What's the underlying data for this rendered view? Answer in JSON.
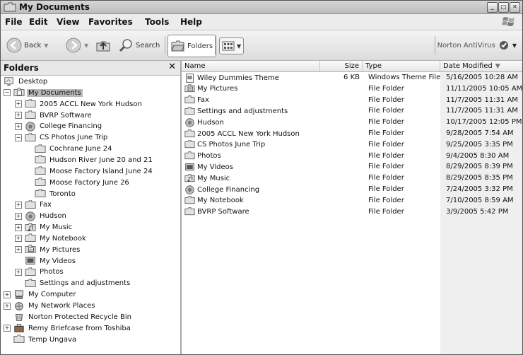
{
  "window": {
    "title": "My Documents",
    "controls": [
      "minimize",
      "maximize",
      "close"
    ]
  },
  "menubar": {
    "items": [
      "File",
      "Edit",
      "View",
      "Favorites",
      "Tools",
      "Help"
    ]
  },
  "toolbar": {
    "back_label": "Back",
    "search_label": "Search",
    "folders_label": "Folders",
    "norton_label": "Norton AntiVirus"
  },
  "folders_pane": {
    "title": "Folders",
    "tree": [
      {
        "label": "Desktop",
        "icon": "desktop-icon",
        "depth": 0,
        "expander": "none"
      },
      {
        "label": "My Documents",
        "icon": "my-documents-icon",
        "depth": 1,
        "expander": "minus",
        "selected": true
      },
      {
        "label": "2005 ACCL New York Hudson",
        "icon": "folder-icon",
        "depth": 2,
        "expander": "plus"
      },
      {
        "label": "BVRP Software",
        "icon": "folder-icon",
        "depth": 2,
        "expander": "plus"
      },
      {
        "label": "College Financing",
        "icon": "special-folder-icon",
        "depth": 2,
        "expander": "plus"
      },
      {
        "label": "CS Photos June Trip",
        "icon": "folder-icon",
        "depth": 2,
        "expander": "minus"
      },
      {
        "label": "Cochrane June 24",
        "icon": "folder-icon",
        "depth": 3,
        "expander": "none"
      },
      {
        "label": "Hudson River June 20 and 21",
        "icon": "folder-icon",
        "depth": 3,
        "expander": "none"
      },
      {
        "label": "Moose Factory Island June 24",
        "icon": "folder-icon",
        "depth": 3,
        "expander": "none"
      },
      {
        "label": "Moose Factory June 26",
        "icon": "folder-icon",
        "depth": 3,
        "expander": "none"
      },
      {
        "label": "Toronto",
        "icon": "folder-icon",
        "depth": 3,
        "expander": "none"
      },
      {
        "label": "Fax",
        "icon": "folder-icon",
        "depth": 2,
        "expander": "plus"
      },
      {
        "label": "Hudson",
        "icon": "special-folder-icon",
        "depth": 2,
        "expander": "plus"
      },
      {
        "label": "My Music",
        "icon": "music-folder-icon",
        "depth": 2,
        "expander": "plus"
      },
      {
        "label": "My Notebook",
        "icon": "folder-icon",
        "depth": 2,
        "expander": "plus"
      },
      {
        "label": "My Pictures",
        "icon": "pictures-folder-icon",
        "depth": 2,
        "expander": "plus"
      },
      {
        "label": "My Videos",
        "icon": "video-folder-icon",
        "depth": 2,
        "expander": "none"
      },
      {
        "label": "Photos",
        "icon": "folder-icon",
        "depth": 2,
        "expander": "plus"
      },
      {
        "label": "Settings and adjustments",
        "icon": "folder-icon",
        "depth": 2,
        "expander": "none"
      },
      {
        "label": "My Computer",
        "icon": "computer-icon",
        "depth": 0,
        "expander": "plus"
      },
      {
        "label": "My Network Places",
        "icon": "network-icon",
        "depth": 0,
        "expander": "plus"
      },
      {
        "label": "Norton Protected Recycle Bin",
        "icon": "recycle-bin-icon",
        "depth": 0,
        "expander": "none"
      },
      {
        "label": "Remy Briefcase from Toshiba",
        "icon": "briefcase-icon",
        "depth": 0,
        "expander": "plus"
      },
      {
        "label": "Temp Ungava",
        "icon": "folder-icon",
        "depth": 0,
        "expander": "none"
      }
    ]
  },
  "file_list": {
    "columns": {
      "name": "Name",
      "size": "Size",
      "type": "Type",
      "date": "Date Modified"
    },
    "sort_column": "date",
    "rows": [
      {
        "name": "Wiley Dummies Theme",
        "size": "6 KB",
        "type": "Windows Theme File",
        "date": "5/16/2005 10:28 AM",
        "icon": "theme-file-icon"
      },
      {
        "name": "My Pictures",
        "size": "",
        "type": "File Folder",
        "date": "11/11/2005 10:05 AM",
        "icon": "pictures-folder-icon"
      },
      {
        "name": "Fax",
        "size": "",
        "type": "File Folder",
        "date": "11/7/2005 11:31 AM",
        "icon": "folder-icon"
      },
      {
        "name": "Settings and adjustments",
        "size": "",
        "type": "File Folder",
        "date": "11/7/2005 11:31 AM",
        "icon": "folder-icon"
      },
      {
        "name": "Hudson",
        "size": "",
        "type": "File Folder",
        "date": "10/17/2005 12:05 PM",
        "icon": "special-folder-icon"
      },
      {
        "name": "2005 ACCL New York Hudson",
        "size": "",
        "type": "File Folder",
        "date": "9/28/2005 7:54 AM",
        "icon": "folder-icon"
      },
      {
        "name": "CS Photos June Trip",
        "size": "",
        "type": "File Folder",
        "date": "9/25/2005 3:35 PM",
        "icon": "folder-icon"
      },
      {
        "name": "Photos",
        "size": "",
        "type": "File Folder",
        "date": "9/4/2005 8:30 AM",
        "icon": "folder-icon"
      },
      {
        "name": "My Videos",
        "size": "",
        "type": "File Folder",
        "date": "8/29/2005 8:39 PM",
        "icon": "video-folder-icon"
      },
      {
        "name": "My Music",
        "size": "",
        "type": "File Folder",
        "date": "8/29/2005 8:35 PM",
        "icon": "music-folder-icon"
      },
      {
        "name": "College Financing",
        "size": "",
        "type": "File Folder",
        "date": "7/24/2005 3:32 PM",
        "icon": "special-folder-icon"
      },
      {
        "name": "My Notebook",
        "size": "",
        "type": "File Folder",
        "date": "7/10/2005 8:59 AM",
        "icon": "folder-icon"
      },
      {
        "name": "BVRP Software",
        "size": "",
        "type": "File Folder",
        "date": "3/9/2005 5:42 PM",
        "icon": "folder-icon"
      }
    ]
  }
}
